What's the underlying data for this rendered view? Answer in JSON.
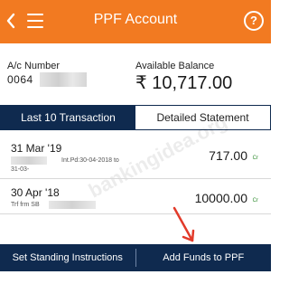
{
  "header": {
    "title": "PPF Account"
  },
  "account": {
    "number_label": "A/c Number",
    "number_visible": "0064",
    "balance_label": "Available Balance",
    "balance_value": "₹ 10,717.00"
  },
  "tabs": [
    {
      "label": "Last 10 Transaction",
      "active": true
    },
    {
      "label": "Detailed Statement",
      "active": false
    }
  ],
  "transactions": [
    {
      "date": "31 Mar '19",
      "desc_line1": "Int.Pd:30-04-2018 to",
      "desc_line2": "31-03-",
      "amount": "717.00",
      "type": "Cr"
    },
    {
      "date": "30 Apr '18",
      "desc_line1": "Trf frm SB",
      "amount": "10000.00",
      "type": "Cr"
    }
  ],
  "watermark": "bankingidea.org",
  "bottom_bar": {
    "left_label": "Set Standing Instructions",
    "right_label": "Add Funds to PPF"
  },
  "colors": {
    "header": "#f27a21",
    "navy": "#0f2a4f",
    "credit": "#2e8b2e",
    "annotation_arrow": "#e23a2a"
  },
  "icons": {
    "back": "back-chevron-icon",
    "menu": "hamburger-menu-icon",
    "help": "help-question-icon"
  }
}
